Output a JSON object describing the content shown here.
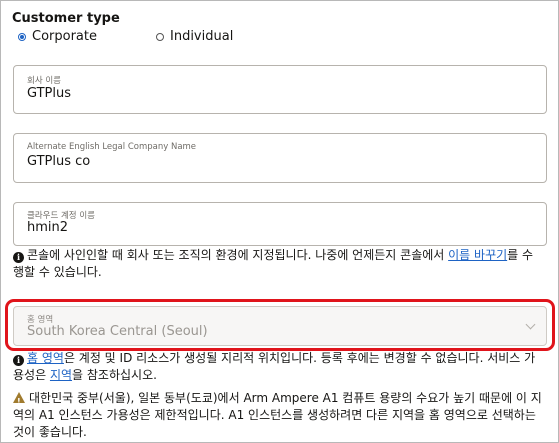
{
  "customer_type": {
    "title": "Customer type",
    "options": [
      {
        "label": "Corporate",
        "selected": true
      },
      {
        "label": "Individual",
        "selected": false
      }
    ]
  },
  "fields": {
    "company_name": {
      "label": "회사 이름",
      "value": "GTPlus"
    },
    "alt_english_name": {
      "label": "Alternate English Legal Company Name",
      "value": "GTPlus co"
    },
    "cloud_account_name": {
      "label": "클라우드 계정 이름",
      "value": "hmin2"
    }
  },
  "account_info": {
    "text_before": "콘솔에 사인인할 때 회사 또는 조직의 환경에 지정됩니다. 나중에 언제든지 콘솔에서 ",
    "link": "이름 바꾸기",
    "text_after": "를 수행할 수 있습니다."
  },
  "home_region": {
    "label": "홈 영역",
    "value": "South Korea Central (Seoul)",
    "disabled": true
  },
  "region_info": {
    "link1": "홈 영역",
    "text_mid": "은 계정 및 ID 리소스가 생성될 지리적 위치입니다. 등록 후에는 변경할 수 없습니다. 서비스 가용성은 ",
    "link2": "지역",
    "text_after": "을 참조하십시오."
  },
  "warning": {
    "text": "대한민국 중부(서울), 일본 동부(도쿄)에서 Arm Ampere A1 컴퓨트 용량의 수요가 높기 때문에 이 지역의 A1 인스턴스 가용성은 제한적입니다. A1 인스턴스를 생성하려면 다른 지역을 홈 영역으로 선택하는 것이 좋습니다."
  },
  "colors": {
    "accent": "#e0141b",
    "link": "#1e63c4"
  }
}
